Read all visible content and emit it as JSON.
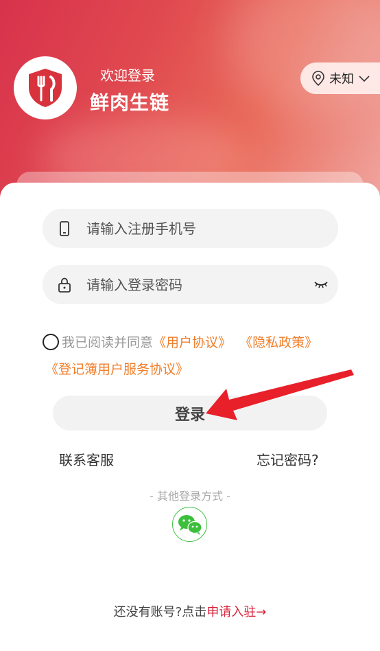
{
  "header": {
    "welcome": "欢迎登录",
    "app_name": "鲜肉生链",
    "location_label": "未知"
  },
  "form": {
    "phone_placeholder": "请输入注册手机号",
    "password_placeholder": "请输入登录密码"
  },
  "agreement": {
    "prefix": "我已阅读并同意",
    "user_agreement": "《用户协议》",
    "privacy_policy": "《隐私政策》",
    "registry_agreement": "《登记簿用户服务协议》"
  },
  "actions": {
    "login_label": "登录",
    "contact_label": "联系客服",
    "forgot_label": "忘记密码?",
    "other_login_label": "- 其他登录方式 -"
  },
  "signup": {
    "prompt": "还没有账号?点击",
    "link": "申请入驻",
    "arrow": "→"
  },
  "colors": {
    "accent_orange": "#f07e2a",
    "accent_red": "#d8223a",
    "wechat_green": "#3cbf3c",
    "annotation_arrow": "#e8202a"
  }
}
